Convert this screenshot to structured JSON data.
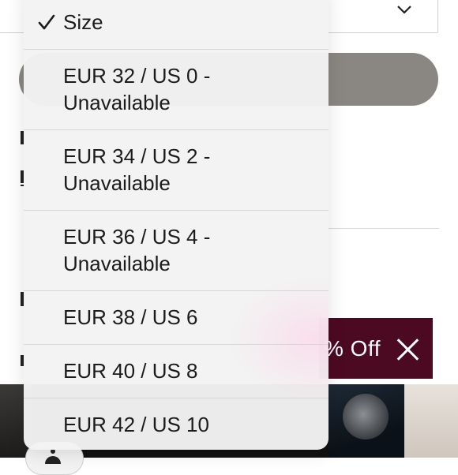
{
  "picker": {
    "options": [
      {
        "label": "Size",
        "selected": true
      },
      {
        "label": "EUR 32 / US 0 -\nUnavailable",
        "selected": false
      },
      {
        "label": "EUR 34 / US 2 -\nUnavailable",
        "selected": false
      },
      {
        "label": "EUR 36 / US 4 -\nUnavailable",
        "selected": false
      },
      {
        "label": "EUR 38 / US 6",
        "selected": false
      },
      {
        "label": "EUR 40 / US 8",
        "selected": false
      },
      {
        "label": "EUR 42 / US 10",
        "selected": false
      }
    ]
  },
  "promo": {
    "text": "% Off",
    "close_icon": "close-icon",
    "color": "#4c0a22"
  },
  "icons": {
    "check": "checkmark-icon",
    "dropdown": "chevron-down-icon",
    "account": "user-icon"
  }
}
